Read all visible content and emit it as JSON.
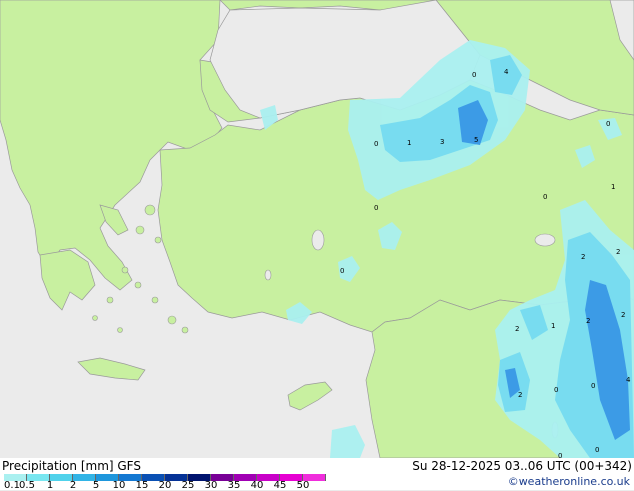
{
  "legend": {
    "title": "Precipitation [mm] GFS",
    "run": "Su 28-12-2025 03..06 UTC (00+342)",
    "credit": "©weatheronline.co.uk",
    "ticks": [
      "0.1",
      "0.5",
      "1",
      "2",
      "5",
      "10",
      "15",
      "20",
      "25",
      "30",
      "35",
      "40",
      "45",
      "50"
    ],
    "colors": [
      "#aaf0f0",
      "#78e6f0",
      "#50d2eb",
      "#32b4e6",
      "#1e96dc",
      "#1478d2",
      "#0a50b4",
      "#053296",
      "#00146e",
      "#780096",
      "#a000b4",
      "#c800c8",
      "#e600d2",
      "#f02ddc"
    ]
  },
  "map": {
    "land_color": "#c8f0a0",
    "sea_color": "#ebebeb",
    "precip_light": "#aaf0f0",
    "precip_mid": "#78dcf0",
    "precip_heavy": "#3c9be6",
    "value_labels": [
      "0",
      "4",
      "0",
      "1",
      "3",
      "5",
      "0",
      "0",
      "1",
      "0",
      "0",
      "2",
      "2",
      "2",
      "1",
      "2",
      "2",
      "2",
      "0",
      "0",
      "4",
      "0",
      "0"
    ]
  }
}
